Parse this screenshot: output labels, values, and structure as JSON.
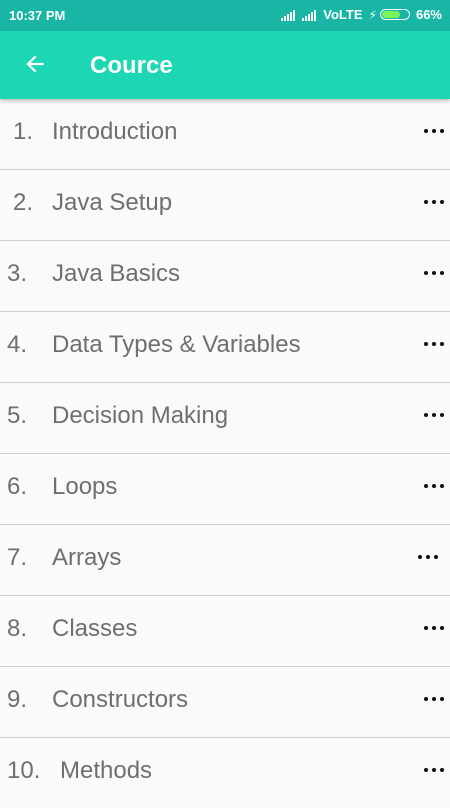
{
  "status": {
    "time": "10:37 PM",
    "network": "VoLTE",
    "battery": "66%",
    "battery_level": 0.66
  },
  "appbar": {
    "title": "Cource",
    "back_icon": "arrow-left-icon"
  },
  "lessons": [
    {
      "num": "1.",
      "label": "Introduction"
    },
    {
      "num": "2.",
      "label": "Java Setup"
    },
    {
      "num": "3.",
      "label": "Java Basics"
    },
    {
      "num": "4.",
      "label": "Data Types & Variables"
    },
    {
      "num": "5.",
      "label": "Decision Making"
    },
    {
      "num": "6.",
      "label": "Loops"
    },
    {
      "num": "7.",
      "label": "Arrays"
    },
    {
      "num": "8.",
      "label": "Classes"
    },
    {
      "num": "9.",
      "label": "Constructors"
    },
    {
      "num": "10.",
      "label": "Methods"
    }
  ],
  "colors": {
    "statusbar": "#19b6a6",
    "appbar": "#1dd6b4",
    "text": "#6f6f6f",
    "divider": "#cfcfcf"
  }
}
